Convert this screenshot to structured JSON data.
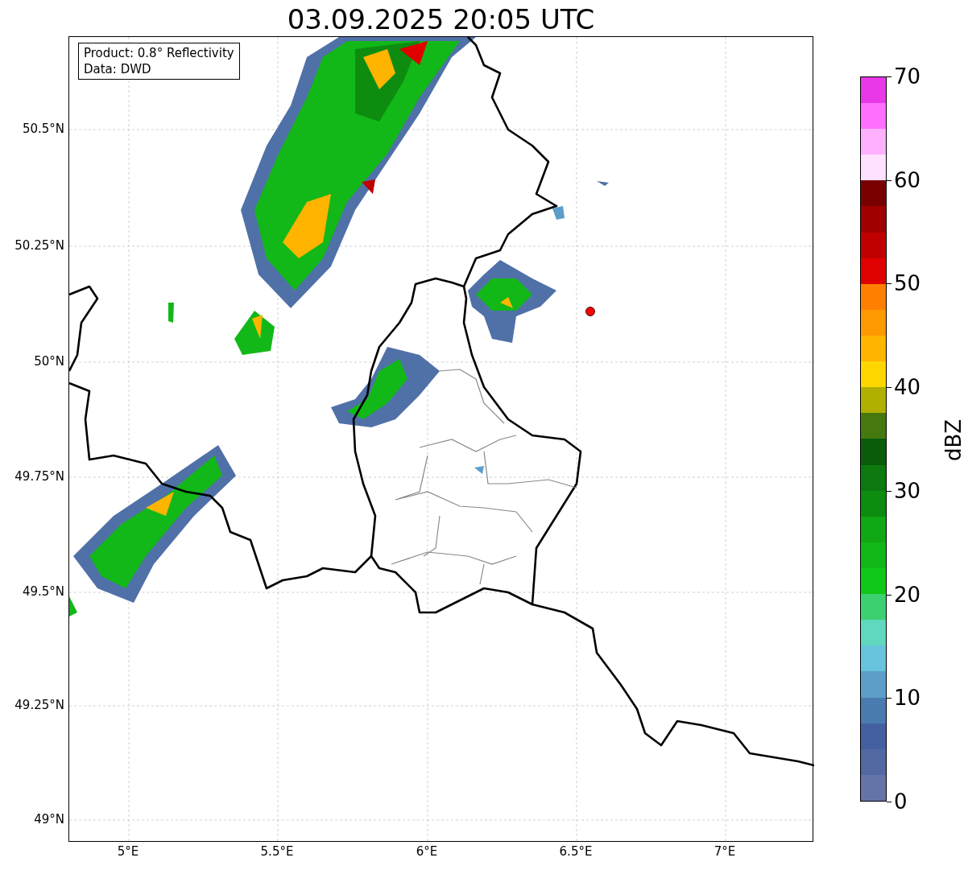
{
  "title": "03.09.2025 20:05 UTC",
  "info_box": [
    "Product: 0.8° Reflectivity",
    "Data: DWD"
  ],
  "lat_labels": [
    "50.5°N",
    "50.25°N",
    "50°N",
    "49.75°N",
    "49.5°N",
    "49.25°N",
    "49°N"
  ],
  "lon_labels": [
    "5°E",
    "5.5°E",
    "6°E",
    "6.5°E",
    "7°E"
  ],
  "colorbar": {
    "label": "dBZ",
    "tick_labels": [
      "70",
      "60",
      "50",
      "40",
      "30",
      "20",
      "10",
      "0"
    ],
    "bins": [
      {
        "color": "#6574a8"
      },
      {
        "color": "#5169a0"
      },
      {
        "color": "#4460a0"
      },
      {
        "color": "#4a7bb0"
      },
      {
        "color": "#5c9ec8"
      },
      {
        "color": "#68c4dc"
      },
      {
        "color": "#60d8c0"
      },
      {
        "color": "#3cd070"
      },
      {
        "color": "#10c818"
      },
      {
        "color": "#12b818"
      },
      {
        "color": "#10a814"
      },
      {
        "color": "#0e8c10"
      },
      {
        "color": "#0d7a0f"
      },
      {
        "color": "#085c0a"
      },
      {
        "color": "#467810"
      },
      {
        "color": "#b0b000"
      },
      {
        "color": "#ffd700"
      },
      {
        "color": "#ffb400"
      },
      {
        "color": "#ff9900"
      },
      {
        "color": "#ff8000"
      },
      {
        "color": "#e00000"
      },
      {
        "color": "#c00000"
      },
      {
        "color": "#a00000"
      },
      {
        "color": "#780000"
      },
      {
        "color": "#ffe0ff"
      },
      {
        "color": "#ffb0ff"
      },
      {
        "color": "#ff70ff"
      },
      {
        "color": "#e838e8"
      }
    ]
  }
}
